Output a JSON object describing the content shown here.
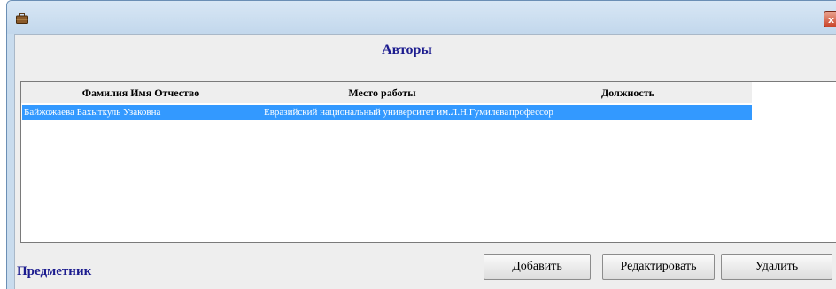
{
  "window": {
    "close_glyph": "x",
    "icon": "briefcase-icon"
  },
  "form": {
    "title": "Авторы"
  },
  "table": {
    "columns": [
      "Фамилия Имя Отчество",
      "Место работы",
      "Должность"
    ],
    "rows": [
      [
        "Байжожаева Бахыткуль Узаковна",
        "Евразийский национальный университет им.Л.Н.Гумилева",
        "профессор"
      ]
    ],
    "selected_row": 0,
    "selection_color": "#3399ff"
  },
  "footer": {
    "section_label": "Предметник",
    "add_label": "Добавить",
    "edit_label": "Редактировать",
    "delete_label": "Удалить"
  },
  "colors": {
    "title_text": "#1c1c8f",
    "titlebar": "#c9dcee",
    "close_button": "#c9442a"
  }
}
